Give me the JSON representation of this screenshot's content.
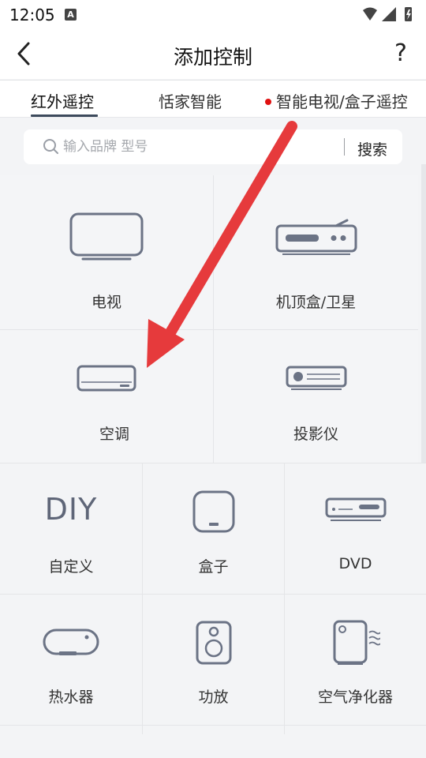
{
  "status_bar": {
    "time": "12:05",
    "notification_badge": "A"
  },
  "header": {
    "title": "添加控制",
    "back_icon": "chevron-left-icon",
    "help_label": "?"
  },
  "tabs": [
    {
      "label": "红外遥控",
      "selected": true
    },
    {
      "label": "恬家智能",
      "selected": false
    },
    {
      "label": "智能电视/盒子遥控",
      "selected": false,
      "has_dot": true
    }
  ],
  "search": {
    "placeholder": "输入品牌 型号",
    "value": "",
    "button_label": "搜索"
  },
  "featured_devices": [
    {
      "label": "电视",
      "icon": "tv-icon"
    },
    {
      "label": "机顶盒/卫星",
      "icon": "set-top-box-icon"
    },
    {
      "label": "空调",
      "icon": "air-conditioner-icon"
    },
    {
      "label": "投影仪",
      "icon": "projector-icon"
    }
  ],
  "devices": [
    {
      "label": "自定义",
      "icon_text": "DIY"
    },
    {
      "label": "盒子",
      "icon": "box-icon"
    },
    {
      "label": "DVD",
      "icon": "dvd-icon"
    },
    {
      "label": "热水器",
      "icon": "water-heater-icon"
    },
    {
      "label": "功放",
      "icon": "amplifier-speaker-icon"
    },
    {
      "label": "空气净化器",
      "icon": "air-purifier-icon"
    }
  ],
  "colors": {
    "icon_stroke": "#6b7385",
    "arrow": "#e63a3c",
    "tab_underline": "#3d4a5c",
    "dot": "#e01010"
  }
}
